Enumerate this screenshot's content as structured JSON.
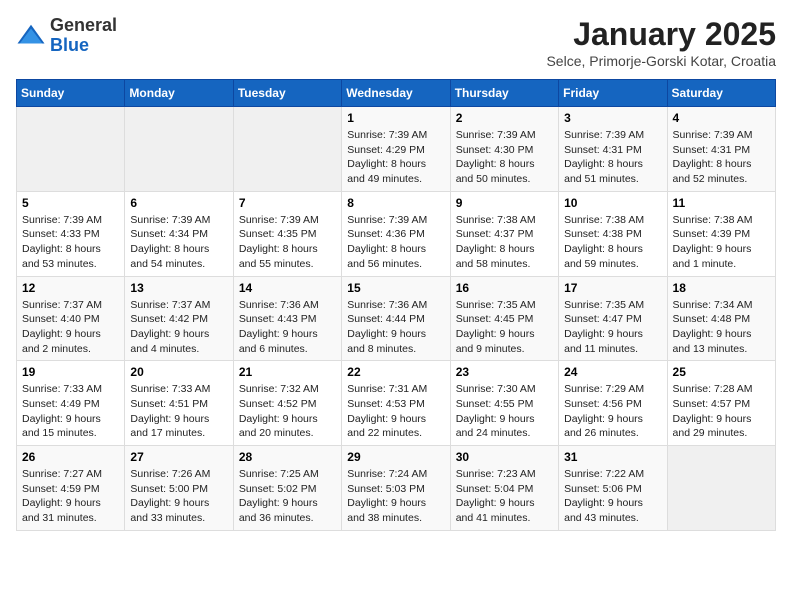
{
  "logo": {
    "general": "General",
    "blue": "Blue"
  },
  "header": {
    "title": "January 2025",
    "location": "Selce, Primorje-Gorski Kotar, Croatia"
  },
  "weekdays": [
    "Sunday",
    "Monday",
    "Tuesday",
    "Wednesday",
    "Thursday",
    "Friday",
    "Saturday"
  ],
  "weeks": [
    [
      {
        "day": "",
        "info": ""
      },
      {
        "day": "",
        "info": ""
      },
      {
        "day": "",
        "info": ""
      },
      {
        "day": "1",
        "info": "Sunrise: 7:39 AM\nSunset: 4:29 PM\nDaylight: 8 hours\nand 49 minutes."
      },
      {
        "day": "2",
        "info": "Sunrise: 7:39 AM\nSunset: 4:30 PM\nDaylight: 8 hours\nand 50 minutes."
      },
      {
        "day": "3",
        "info": "Sunrise: 7:39 AM\nSunset: 4:31 PM\nDaylight: 8 hours\nand 51 minutes."
      },
      {
        "day": "4",
        "info": "Sunrise: 7:39 AM\nSunset: 4:31 PM\nDaylight: 8 hours\nand 52 minutes."
      }
    ],
    [
      {
        "day": "5",
        "info": "Sunrise: 7:39 AM\nSunset: 4:33 PM\nDaylight: 8 hours\nand 53 minutes."
      },
      {
        "day": "6",
        "info": "Sunrise: 7:39 AM\nSunset: 4:34 PM\nDaylight: 8 hours\nand 54 minutes."
      },
      {
        "day": "7",
        "info": "Sunrise: 7:39 AM\nSunset: 4:35 PM\nDaylight: 8 hours\nand 55 minutes."
      },
      {
        "day": "8",
        "info": "Sunrise: 7:39 AM\nSunset: 4:36 PM\nDaylight: 8 hours\nand 56 minutes."
      },
      {
        "day": "9",
        "info": "Sunrise: 7:38 AM\nSunset: 4:37 PM\nDaylight: 8 hours\nand 58 minutes."
      },
      {
        "day": "10",
        "info": "Sunrise: 7:38 AM\nSunset: 4:38 PM\nDaylight: 8 hours\nand 59 minutes."
      },
      {
        "day": "11",
        "info": "Sunrise: 7:38 AM\nSunset: 4:39 PM\nDaylight: 9 hours\nand 1 minute."
      }
    ],
    [
      {
        "day": "12",
        "info": "Sunrise: 7:37 AM\nSunset: 4:40 PM\nDaylight: 9 hours\nand 2 minutes."
      },
      {
        "day": "13",
        "info": "Sunrise: 7:37 AM\nSunset: 4:42 PM\nDaylight: 9 hours\nand 4 minutes."
      },
      {
        "day": "14",
        "info": "Sunrise: 7:36 AM\nSunset: 4:43 PM\nDaylight: 9 hours\nand 6 minutes."
      },
      {
        "day": "15",
        "info": "Sunrise: 7:36 AM\nSunset: 4:44 PM\nDaylight: 9 hours\nand 8 minutes."
      },
      {
        "day": "16",
        "info": "Sunrise: 7:35 AM\nSunset: 4:45 PM\nDaylight: 9 hours\nand 9 minutes."
      },
      {
        "day": "17",
        "info": "Sunrise: 7:35 AM\nSunset: 4:47 PM\nDaylight: 9 hours\nand 11 minutes."
      },
      {
        "day": "18",
        "info": "Sunrise: 7:34 AM\nSunset: 4:48 PM\nDaylight: 9 hours\nand 13 minutes."
      }
    ],
    [
      {
        "day": "19",
        "info": "Sunrise: 7:33 AM\nSunset: 4:49 PM\nDaylight: 9 hours\nand 15 minutes."
      },
      {
        "day": "20",
        "info": "Sunrise: 7:33 AM\nSunset: 4:51 PM\nDaylight: 9 hours\nand 17 minutes."
      },
      {
        "day": "21",
        "info": "Sunrise: 7:32 AM\nSunset: 4:52 PM\nDaylight: 9 hours\nand 20 minutes."
      },
      {
        "day": "22",
        "info": "Sunrise: 7:31 AM\nSunset: 4:53 PM\nDaylight: 9 hours\nand 22 minutes."
      },
      {
        "day": "23",
        "info": "Sunrise: 7:30 AM\nSunset: 4:55 PM\nDaylight: 9 hours\nand 24 minutes."
      },
      {
        "day": "24",
        "info": "Sunrise: 7:29 AM\nSunset: 4:56 PM\nDaylight: 9 hours\nand 26 minutes."
      },
      {
        "day": "25",
        "info": "Sunrise: 7:28 AM\nSunset: 4:57 PM\nDaylight: 9 hours\nand 29 minutes."
      }
    ],
    [
      {
        "day": "26",
        "info": "Sunrise: 7:27 AM\nSunset: 4:59 PM\nDaylight: 9 hours\nand 31 minutes."
      },
      {
        "day": "27",
        "info": "Sunrise: 7:26 AM\nSunset: 5:00 PM\nDaylight: 9 hours\nand 33 minutes."
      },
      {
        "day": "28",
        "info": "Sunrise: 7:25 AM\nSunset: 5:02 PM\nDaylight: 9 hours\nand 36 minutes."
      },
      {
        "day": "29",
        "info": "Sunrise: 7:24 AM\nSunset: 5:03 PM\nDaylight: 9 hours\nand 38 minutes."
      },
      {
        "day": "30",
        "info": "Sunrise: 7:23 AM\nSunset: 5:04 PM\nDaylight: 9 hours\nand 41 minutes."
      },
      {
        "day": "31",
        "info": "Sunrise: 7:22 AM\nSunset: 5:06 PM\nDaylight: 9 hours\nand 43 minutes."
      },
      {
        "day": "",
        "info": ""
      }
    ]
  ]
}
